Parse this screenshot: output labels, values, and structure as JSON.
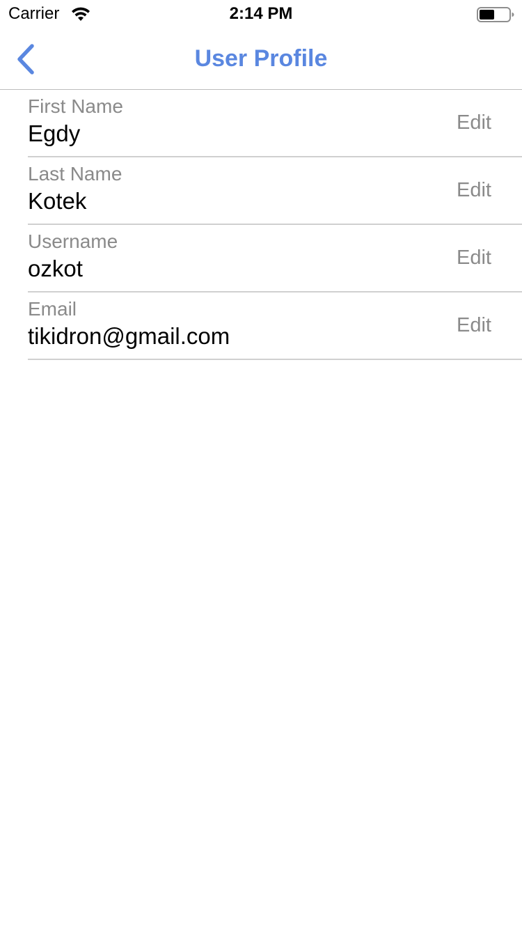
{
  "status_bar": {
    "carrier": "Carrier",
    "time": "2:14 PM",
    "wifi_icon": "wifi-icon",
    "battery_icon": "battery-icon"
  },
  "nav": {
    "title": "User Profile",
    "back_icon": "chevron-left-icon",
    "accent_color": "#5a87e0"
  },
  "profile": {
    "fields": [
      {
        "label": "First Name",
        "value": "Egdy",
        "action": "Edit"
      },
      {
        "label": "Last Name",
        "value": "Kotek",
        "action": "Edit"
      },
      {
        "label": "Username",
        "value": "ozkot",
        "action": "Edit"
      },
      {
        "label": "Email",
        "value": "tikidron@gmail.com",
        "action": "Edit"
      }
    ]
  }
}
